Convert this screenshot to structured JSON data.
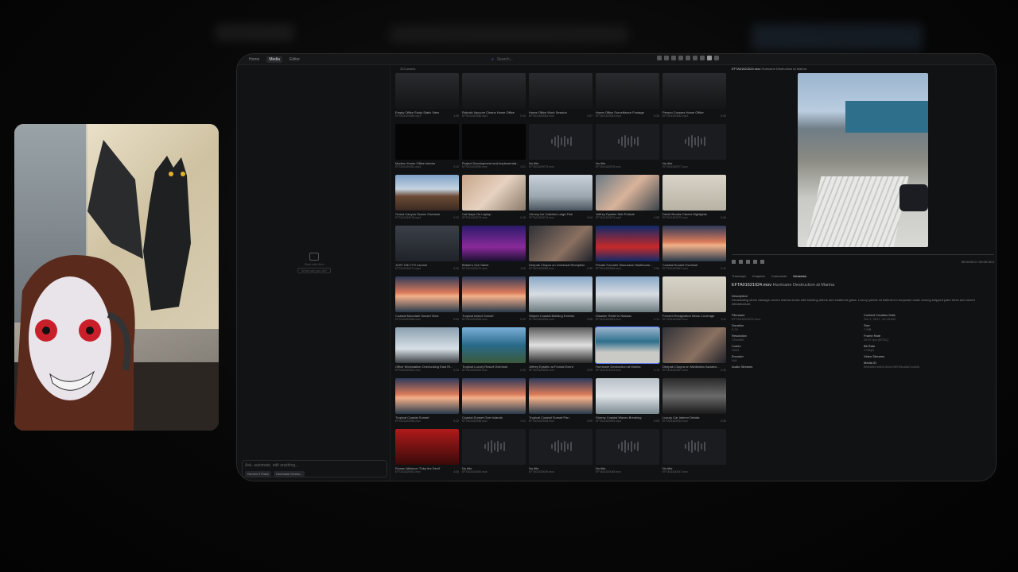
{
  "nav": [
    "Home",
    "Media",
    "Editor"
  ],
  "search_placeholder": "Search...",
  "asset_count": "333 assets",
  "chat": {
    "empty_text": "Start with files",
    "empty_button": "What can you do?",
    "input_placeholder": "Ask, automate, edit anything...",
    "model": "Gemini 3 Flash",
    "context_tag": "Hurricane Destru..."
  },
  "tiles": [
    {
      "title": "Empty Office Study Static View",
      "file": "EFTA01620086.mp4",
      "dur": "1:00",
      "kind": "dark"
    },
    {
      "title": "Robotic Vacuum Cleans Home Office",
      "file": "EFTA01620085.mp4",
      "dur": "0:10",
      "kind": "dark"
    },
    {
      "title": "Home Office Work Session",
      "file": "EFTA01620084.mov",
      "dur": "0:07",
      "kind": "dark"
    },
    {
      "title": "Home Office Surveillance Footage",
      "file": "EFTA01620083.mp4",
      "dur": "0:26",
      "kind": "dark"
    },
    {
      "title": "Person Crosses Home Office",
      "file": "EFTA01620082.mp4",
      "dur": "0:20",
      "kind": "dark"
    },
    {
      "title": "Modern Home Office Interior",
      "file": "EFTA01620081.mp4",
      "dur": "0:10",
      "kind": "black"
    },
    {
      "title": "Project Development and Implementat...",
      "file": "EFTA01620080.mov",
      "dur": "0:11",
      "kind": "black"
    },
    {
      "title": "No title",
      "file": "EFTA01620079.mov",
      "dur": "",
      "kind": "audio"
    },
    {
      "title": "No title",
      "file": "EFTA01620078.mov",
      "dur": "",
      "kind": "audio"
    },
    {
      "title": "No title",
      "file": "EFTA01620077.mov",
      "dur": "",
      "kind": "audio"
    },
    {
      "title": "Grand Canyon Scenic Overlook",
      "file": "EFTA01620076.mp4",
      "dur": "0:12",
      "kind": "canyon"
    },
    {
      "title": "Cat Naps On Laptop",
      "file": "EFTA01620075.mov",
      "dur": "0:15",
      "kind": "cat"
    },
    {
      "title": "Johnny Ive Catches Large Fish",
      "file": "EFTA01620074.mov",
      "dur": "0:04",
      "kind": "fish"
    },
    {
      "title": "Jeffrey Epstein Self-Portrait",
      "file": "EFTA01620073.mp4",
      "dur": "0:08",
      "kind": "face"
    },
    {
      "title": "David Brooks Career Highlights",
      "file": "EFTA01620072.mov",
      "dur": "0:06",
      "kind": "doc"
    },
    {
      "title": "JUST DID IT!!! Launch",
      "file": "EFTA01620071.mp4",
      "dur": "0:40",
      "kind": "suits"
    },
    {
      "title": "Britain's Got Talent",
      "file": "EFTA01620070.mov",
      "dur": "1:20",
      "kind": "stage"
    },
    {
      "title": "Deepak Chopra on Universal Reception",
      "file": "EFTA01620069.mov",
      "dur": "0:30",
      "kind": "talk"
    },
    {
      "title": "Private Founder Discusses Healthcare...",
      "file": "EFTA01620068.mov",
      "dur": "2:06",
      "kind": "news"
    },
    {
      "title": "Coastal Sunset Overlook",
      "file": "EFTA01620067.mov",
      "dur": "0:10",
      "kind": "sunset"
    },
    {
      "title": "Coastal Mountain Sunset View",
      "file": "EFTA01620066.mov",
      "dur": "0:09",
      "kind": "sunset"
    },
    {
      "title": "Tropical Island Sunset",
      "file": "EFTA01620065.mov",
      "dur": "0:12",
      "kind": "sunset"
    },
    {
      "title": "Striped Coastal Building Exterior",
      "file": "EFTA01620064.mov",
      "dur": "0:08",
      "kind": "coast"
    },
    {
      "title": "Disaster Relief in Nassau",
      "file": "EFTA01620063.mov",
      "dur": "0:14",
      "kind": "coast"
    },
    {
      "title": "Fervent Resignation News Coverage",
      "file": "EFTA01620062.mov",
      "dur": "0:11",
      "kind": "doc"
    },
    {
      "title": "Office Workstation Overlooking East Ri...",
      "file": "EFTA01620061.mov",
      "dur": "0:13",
      "kind": "office"
    },
    {
      "title": "Tropical Luxury Resort Overlook",
      "file": "EFTA01620060.mov",
      "dur": "0:10",
      "kind": "resort"
    },
    {
      "title": "Jeffrey Epstein at Formal Event",
      "file": "EFTA01620059.mov",
      "dur": "0:09",
      "kind": "formal"
    },
    {
      "title": "Hurricane Destruction at Marina",
      "file": "EFTA01621024.mov",
      "dur": "0:15",
      "kind": "marina"
    },
    {
      "title": "Deepak Chopra on Meditation Awaken...",
      "file": "EFTA01620057.mov",
      "dur": "0:20",
      "kind": "talk"
    },
    {
      "title": "Tropical Coastal Sunset",
      "file": "EFTA01620056.mov",
      "dur": "0:12",
      "kind": "sunset"
    },
    {
      "title": "Coastal Sunset Over Islands",
      "file": "EFTA01620055.mov",
      "dur": "0:11",
      "kind": "sunset"
    },
    {
      "title": "Tropical Coastal Sunset Pan",
      "file": "EFTA01620054.mov",
      "dur": "0:09",
      "kind": "sunset"
    },
    {
      "title": "Stormy Coastal Waves Breaking",
      "file": "EFTA01620053.mp4",
      "dur": "0:08",
      "kind": "storm"
    },
    {
      "title": "Luxury Car Interior Details",
      "file": "EFTA01620052.mov",
      "dur": "0:06",
      "kind": "car"
    },
    {
      "title": "Rowan Atkinson 'Toby the Devil'",
      "file": "EFTA01620051.mov",
      "dur": "4:35",
      "kind": "toby"
    },
    {
      "title": "No title",
      "file": "EFTA01620050.mov",
      "dur": "",
      "kind": "audio"
    },
    {
      "title": "No title",
      "file": "EFTA01620049.mov",
      "dur": "",
      "kind": "audio"
    },
    {
      "title": "No title",
      "file": "EFTA01620048.mov",
      "dur": "",
      "kind": "audio"
    },
    {
      "title": "No title",
      "file": "EFTA01620047.mov",
      "dur": "",
      "kind": "audio"
    }
  ],
  "detail": {
    "header_file": "EFTA01621024.mov",
    "header_title": "Hurricane Destruction at Marina",
    "time": "00:00:00.0 / 00:00:15.0",
    "tabs": [
      "Transcript",
      "Chapters",
      "Comments",
      "Metadata"
    ],
    "title_file": "EFTA01621024.mov",
    "title_name": "Hurricane Destruction at Marina",
    "desc_label": "Description",
    "desc": "Devastating storm damage covers marina docks with building debris and shattered glass. Luxury yachts sit battered in turquoise water among stripped palm trees and ruined infrastructure.",
    "left": [
      {
        "k": "Filename",
        "v": "EFTA01621024.mov"
      },
      {
        "k": "Duration",
        "v": "0:15"
      },
      {
        "k": "Resolution",
        "v": "720x960"
      },
      {
        "k": "Codec",
        "v": "H264"
      },
      {
        "k": "Encoder",
        "v": "N/A"
      },
      {
        "k": "Audio Streams",
        "v": ""
      }
    ],
    "right": [
      {
        "k": "Content Creation Date",
        "v": "Oct 1, 2017, 10:15 AM"
      },
      {
        "k": "Size",
        "v": "7 MB"
      },
      {
        "k": "Frame Rate",
        "v": "29.97 fps (NTSC)"
      },
      {
        "k": "Bit Rate",
        "v": "4 Mbps"
      },
      {
        "k": "Video Streams",
        "v": ""
      },
      {
        "k": "Media ID",
        "v": "0fd0d4bf-e8b5-4bcd-9fff-95ca8a7cda4b"
      }
    ]
  }
}
